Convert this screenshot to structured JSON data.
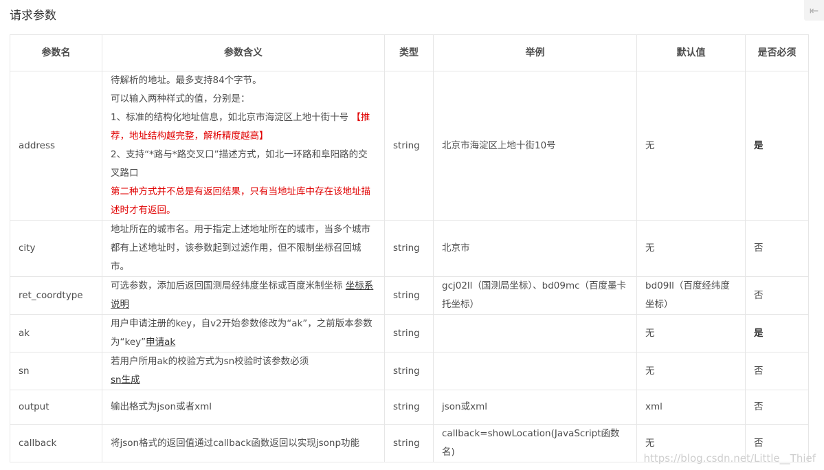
{
  "section_title": "请求参数",
  "corner_icon": "collapse-arrow-icon",
  "headers": [
    "参数名",
    "参数含义",
    "类型",
    "举例",
    "默认值",
    "是否必须"
  ],
  "rows": {
    "address": {
      "name": "address",
      "desc": [
        "待解析的地址。最多支持84个字节。",
        "可以输入两种样式的值，分别是：",
        "1、标准的结构化地址信息，如北京市海淀区上地十街十号",
        "【推荐，地址结构越完整，解析精度越高】",
        "2、支持“*路与*路交叉口”描述方式，如北一环路和阜阳路的交叉路口",
        "第二种方式并不总是有返回结果，只有当地址库中存在该地址描述时才有返回。"
      ],
      "type": "string",
      "example": "北京市海淀区上地十街10号",
      "default": "无",
      "required": "是"
    },
    "city": {
      "name": "city",
      "desc": "地址所在的城市名。用于指定上述地址所在的城市，当多个城市都有上述地址时，该参数起到过滤作用，但不限制坐标召回城市。",
      "type": "string",
      "example": "北京市",
      "default": "无",
      "required": "否"
    },
    "ret_coordtype": {
      "name": "ret_coordtype",
      "desc": "可选参数，添加后返回国测局经纬度坐标或百度米制坐标",
      "link": "坐标系说明",
      "type": "string",
      "example": "gcj02ll（国测局坐标）、bd09mc（百度墨卡托坐标）",
      "default": "bd09ll（百度经纬度坐标）",
      "required": "否"
    },
    "ak": {
      "name": "ak",
      "desc": "用户申请注册的key，自v2开始参数修改为“ak”，之前版本参数为“key”",
      "link": "申请ak",
      "type": "string",
      "example": "",
      "default": "无",
      "required": "是"
    },
    "sn": {
      "name": "sn",
      "desc": "若用户所用ak的校验方式为sn校验时该参数必须",
      "link": "sn生成",
      "type": "string",
      "example": "",
      "default": "无",
      "required": "否"
    },
    "output": {
      "name": "output",
      "desc": "输出格式为json或者xml",
      "type": "string",
      "example": "json或xml",
      "default": "xml",
      "required": "否"
    },
    "callback": {
      "name": "callback",
      "desc": "将json格式的返回值通过callback函数返回以实现jsonp功能",
      "type": "string",
      "example": "callback=showLocation(JavaScript函数名)",
      "default": "无",
      "required": "否"
    }
  },
  "watermark": "https://blog.csdn.net/Little__Thief"
}
